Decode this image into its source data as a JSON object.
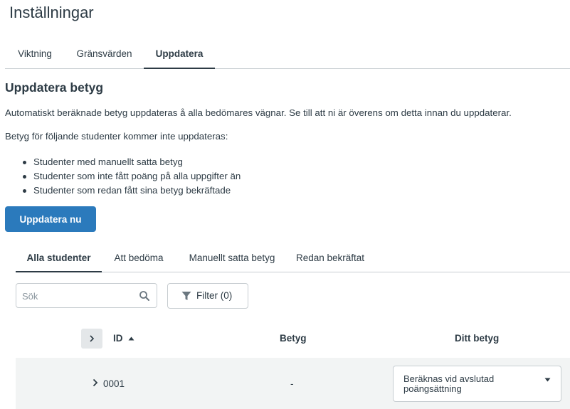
{
  "page": {
    "title": "Inställningar"
  },
  "top_tabs": [
    {
      "label": "Viktning",
      "active": false
    },
    {
      "label": "Gränsvärden",
      "active": false
    },
    {
      "label": "Uppdatera",
      "active": true
    }
  ],
  "section": {
    "title": "Uppdatera betyg",
    "intro": "Automatiskt beräknade betyg uppdateras å alla bedömares vägnar. Se till att ni är överens om detta innan du uppdaterar.",
    "exclusions_intro": "Betyg för följande studenter kommer inte uppdateras:",
    "exclusions": [
      "Studenter med manuellt satta betyg",
      "Studenter som inte fått poäng på alla uppgifter än",
      "Studenter som redan fått sina betyg bekräftade"
    ],
    "update_button": "Uppdatera nu"
  },
  "student_tabs": [
    {
      "label": "Alla studenter",
      "active": true
    },
    {
      "label": "Att bedöma",
      "active": false
    },
    {
      "label": "Manuellt satta betyg",
      "active": false
    },
    {
      "label": "Redan bekräftat",
      "active": false
    }
  ],
  "search": {
    "placeholder": "Sök",
    "value": ""
  },
  "filter": {
    "label": "Filter (0)"
  },
  "table": {
    "columns": {
      "id": "ID",
      "grade": "Betyg",
      "your_grade": "Ditt betyg"
    },
    "rows": [
      {
        "id": "0001",
        "grade": "-",
        "your_grade": "Beräknas vid avslutad poängsättning"
      }
    ]
  },
  "colors": {
    "primary": "#2b7abc",
    "text": "#2d3b45",
    "border": "#c7cdd1",
    "row_bg": "#f2f4f4"
  }
}
